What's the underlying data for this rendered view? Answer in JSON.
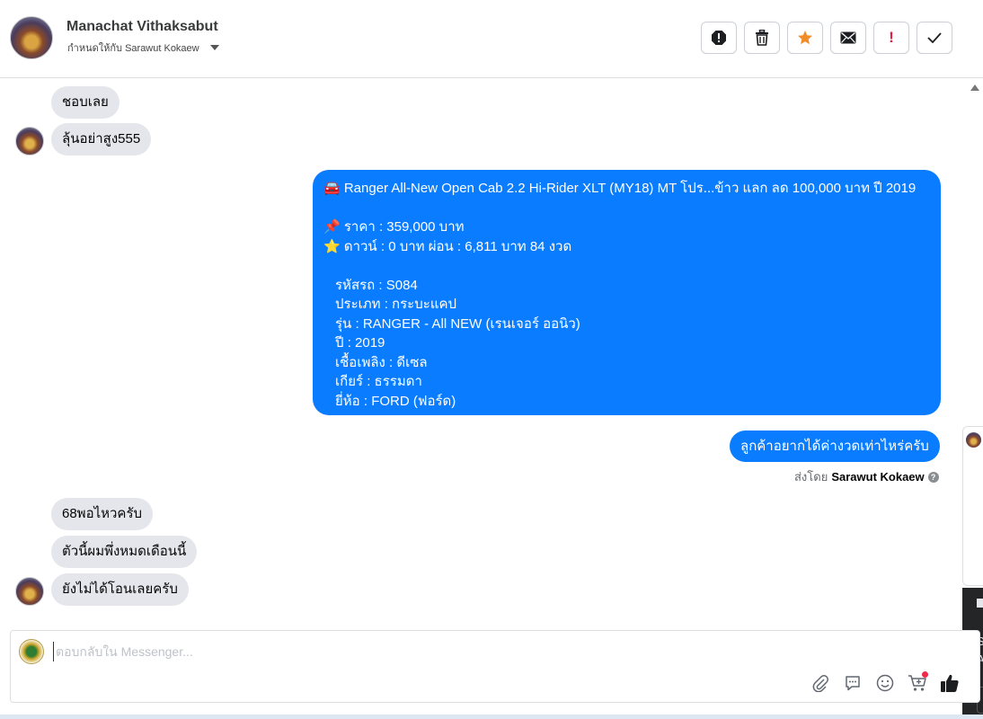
{
  "header": {
    "name": "Manachat Vithaksabut",
    "assigned_to": "กำหนดให้กับ Sarawut Kokaew"
  },
  "toolbar": {
    "icons": [
      "alert-icon",
      "trash-icon",
      "star-icon",
      "mail-icon",
      "important-icon",
      "check-icon"
    ],
    "important_glyph": "!"
  },
  "messages": {
    "in1": "ชอบเลย",
    "in2": "ลุ้นอย่าสูง555",
    "listing": {
      "line1": "🚘 Ranger All-New Open Cab 2.2 Hi-Rider XLT (MY18) MT โปร...ข้าว แลก ลด 100,000 บาท ปี 2019",
      "line2": "📌 ราคา : 359,000 บาท",
      "line3": "⭐ ดาวน์ : 0 บาท ผ่อน : 6,811 บาท 84 งวด",
      "line4": "รหัสรถ : S084",
      "line5": "ประเภท : กระบะแคป",
      "line6": "รุ่น : RANGER - All NEW (เรนเจอร์ ออนิว)",
      "line7": "ปี : 2019",
      "line8": "เชื้อเพลิง : ดีเซล",
      "line9": "เกียร์ : ธรรมดา",
      "line10": "ยี่ห้อ : FORD (ฟอร์ด)"
    },
    "out_question": "ลูกค้าอยากได้ค่างวดเท่าไหร่ครับ",
    "sent_by_prefix": "ส่งโดย",
    "sent_by_name": "Sarawut Kokaew",
    "help_glyph": "?",
    "in3": "68พอไหวครับ",
    "in4": "ตัวนี้ผมพึ่งหมดเดือนนี้",
    "in5": "ยังไม่ได้โอนเลยครับ"
  },
  "composer": {
    "placeholder": "ตอบกลับใน Messenger...",
    "tools": [
      "attach-icon",
      "saved-reply-icon",
      "emoji-icon",
      "cart-icon",
      "like-icon"
    ]
  },
  "side_panel": {
    "text1": "S",
    "text2": "A"
  },
  "colors": {
    "accent": "#0a7cff",
    "incoming_bubble": "#e4e6eb",
    "star": "#f28c28",
    "important": "#e41e3f"
  }
}
